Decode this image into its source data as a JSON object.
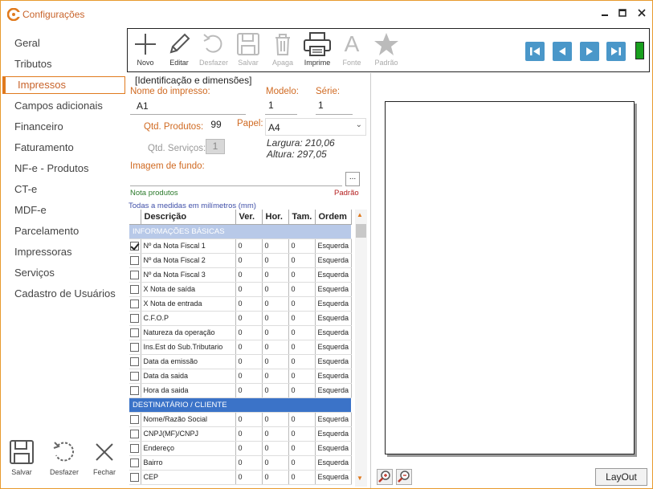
{
  "window": {
    "title": "Configurações",
    "minimize": "🗕",
    "maximize": "☐",
    "close": "✕"
  },
  "sidebar": {
    "items": [
      {
        "label": "Geral"
      },
      {
        "label": "Tributos"
      },
      {
        "label": "Impressos"
      },
      {
        "label": "Campos adicionais"
      },
      {
        "label": "Financeiro"
      },
      {
        "label": "Faturamento"
      },
      {
        "label": "NF-e - Produtos"
      },
      {
        "label": "CT-e"
      },
      {
        "label": "MDF-e"
      },
      {
        "label": "Parcelamento"
      },
      {
        "label": "Impressoras"
      },
      {
        "label": "Serviços"
      },
      {
        "label": "Cadastro de Usuários"
      }
    ],
    "selected": "Impressos",
    "bottom": {
      "save": "Salvar",
      "undo": "Desfazer",
      "close": "Fechar"
    }
  },
  "toolbar": {
    "new": "Novo",
    "edit": "Editar",
    "undo": "Desfazer",
    "save": "Salvar",
    "delete": "Apaga",
    "print": "Imprime",
    "font": "Fonte",
    "default": "Padrão",
    "font_glyph": "A",
    "enabled": [
      "Novo",
      "Editar",
      "Imprime"
    ],
    "status_color": "#19a01e"
  },
  "form": {
    "group_title": "[Identificação e dimensões]",
    "name_label": "Nome do impresso:",
    "name_value": "A1",
    "model_label": "Modelo:",
    "model_value": "1",
    "series_label": "Série:",
    "series_value": "1",
    "qty_products_label": "Qtd. Produtos:",
    "qty_products_value": "99",
    "qty_services_label": "Qtd. Serviços:",
    "qty_services_value": "1",
    "paper_label": "Papel:",
    "paper_value": "A4",
    "width_text": "Largura: 210,06",
    "height_text": "Altura: 297,05",
    "bg_image_label": "Imagem de fundo:",
    "browse_label": "...",
    "note_products": "Nota produtos",
    "default_link": "Padrão",
    "measures_note": "Todas a medidas em milímetros (mm)"
  },
  "grid": {
    "columns": [
      "",
      "Descrição",
      "Ver.",
      "Hor.",
      "Tam.",
      "Ordem"
    ],
    "sections": [
      {
        "title": "INFORMAÇÕES BÁSICAS",
        "rows": [
          {
            "checked": true,
            "desc": "Nº da Nota Fiscal 1",
            "ver": "0",
            "hor": "0",
            "tam": "0",
            "ordem": "Esquerda"
          },
          {
            "checked": false,
            "desc": "Nº da Nota Fiscal 2",
            "ver": "0",
            "hor": "0",
            "tam": "0",
            "ordem": "Esquerda"
          },
          {
            "checked": false,
            "desc": "Nº da Nota Fiscal 3",
            "ver": "0",
            "hor": "0",
            "tam": "0",
            "ordem": "Esquerda"
          },
          {
            "checked": false,
            "desc": "X Nota de saída",
            "ver": "0",
            "hor": "0",
            "tam": "0",
            "ordem": "Esquerda"
          },
          {
            "checked": false,
            "desc": "X Nota de entrada",
            "ver": "0",
            "hor": "0",
            "tam": "0",
            "ordem": "Esquerda"
          },
          {
            "checked": false,
            "desc": "C.F.O.P",
            "ver": "0",
            "hor": "0",
            "tam": "0",
            "ordem": "Esquerda"
          },
          {
            "checked": false,
            "desc": "Natureza da operação",
            "ver": "0",
            "hor": "0",
            "tam": "0",
            "ordem": "Esquerda"
          },
          {
            "checked": false,
            "desc": "Ins.Est do Sub.Tributario",
            "ver": "0",
            "hor": "0",
            "tam": "0",
            "ordem": "Esquerda"
          },
          {
            "checked": false,
            "desc": "Data da emissão",
            "ver": "0",
            "hor": "0",
            "tam": "0",
            "ordem": "Esquerda"
          },
          {
            "checked": false,
            "desc": "Data da saida",
            "ver": "0",
            "hor": "0",
            "tam": "0",
            "ordem": "Esquerda"
          },
          {
            "checked": false,
            "desc": "Hora da saida",
            "ver": "0",
            "hor": "0",
            "tam": "0",
            "ordem": "Esquerda"
          }
        ]
      },
      {
        "title": "DESTINATÁRIO / CLIENTE",
        "rows": [
          {
            "checked": false,
            "desc": "Nome/Razão Social",
            "ver": "0",
            "hor": "0",
            "tam": "0",
            "ordem": "Esquerda"
          },
          {
            "checked": false,
            "desc": "CNPJ(MF)/CNPJ",
            "ver": "0",
            "hor": "0",
            "tam": "0",
            "ordem": "Esquerda"
          },
          {
            "checked": false,
            "desc": "Endereço",
            "ver": "0",
            "hor": "0",
            "tam": "0",
            "ordem": "Esquerda"
          },
          {
            "checked": false,
            "desc": "Bairro",
            "ver": "0",
            "hor": "0",
            "tam": "0",
            "ordem": "Esquerda"
          },
          {
            "checked": false,
            "desc": "CEP",
            "ver": "0",
            "hor": "0",
            "tam": "0",
            "ordem": "Esquerda"
          }
        ]
      }
    ]
  },
  "preview": {
    "layout_button": "LayOut",
    "zoom_in_icon": "zoom-in-icon",
    "zoom_out_icon": "zoom-out-icon"
  }
}
